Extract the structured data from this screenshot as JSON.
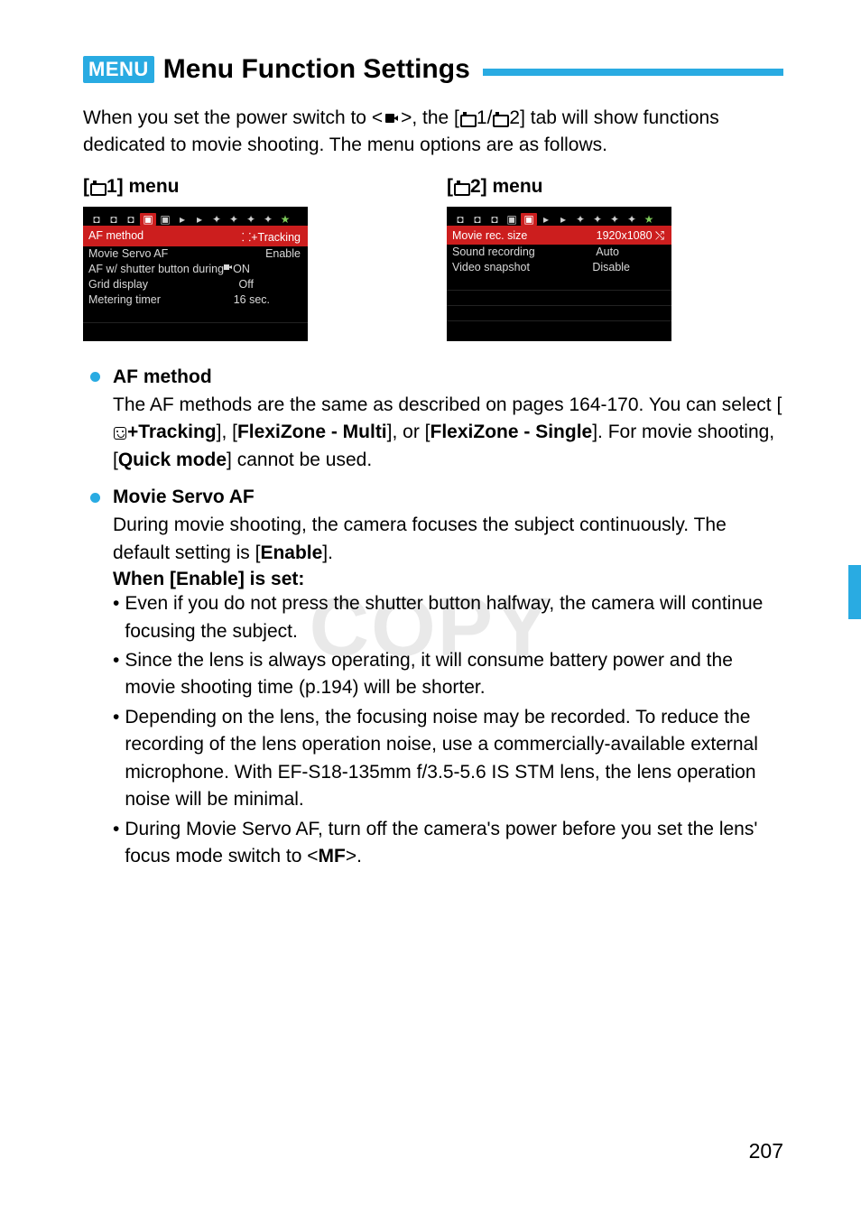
{
  "header": {
    "badge": "MENU",
    "title": "Menu Function Settings"
  },
  "intro": {
    "p1a": "When you set the power switch to <",
    "p1b": ">, the [",
    "p1c": "1/",
    "p1d": "2] tab will show functions dedicated to movie shooting. The menu options are as follows."
  },
  "menu1": {
    "heading_pre": "[",
    "heading_post": "1] menu",
    "items": [
      {
        "label": "AF method",
        "value": "⸬+Tracking"
      },
      {
        "label": "Movie Servo AF",
        "value": "Enable"
      },
      {
        "label": "AF w/ shutter button during ",
        "value": " ON"
      },
      {
        "label": "Grid display",
        "value": "Off"
      },
      {
        "label": "Metering timer",
        "value": "16 sec."
      }
    ]
  },
  "menu2": {
    "heading_pre": "[",
    "heading_post": "2] menu",
    "items": [
      {
        "label": "Movie rec. size",
        "value": "1920x1080 ⤭"
      },
      {
        "label": "Sound recording",
        "value": "Auto"
      },
      {
        "label": "Video snapshot",
        "value": "Disable"
      }
    ]
  },
  "watermark": "COPY",
  "sections": {
    "af_method": {
      "title": "AF method",
      "p1": "The AF methods are the same as described on pages 164-170. You can select [",
      "opt1": "+Tracking",
      "mid1": "], [",
      "opt2": "FlexiZone - Multi",
      "mid2": "], or [",
      "opt3": "FlexiZone - Single",
      "p2": "]. For movie shooting, [",
      "opt4": "Quick mode",
      "p3": "] cannot be used."
    },
    "movie_servo": {
      "title": "Movie Servo AF",
      "body_a": "During movie shooting, the camera focuses the subject continuously. The default setting is [",
      "body_b": "Enable",
      "body_c": "].",
      "subhead": "When [Enable] is set:",
      "bullets": [
        "Even if you do not press the shutter button halfway, the camera will continue focusing the subject.",
        "Since the lens is always operating, it will consume battery power and the movie shooting time (p.194) will be shorter.",
        "Depending on the lens, the focusing noise may be recorded. To reduce the recording of the lens operation noise, use a commercially-available external microphone. With EF-S18-135mm f/3.5-5.6 IS STM lens, the lens operation noise will be minimal."
      ],
      "bullet_mf_a": "During Movie Servo AF, turn off the camera's power before you set the lens' focus mode switch to <",
      "bullet_mf_b": "MF",
      "bullet_mf_c": ">."
    }
  },
  "page_number": "207"
}
